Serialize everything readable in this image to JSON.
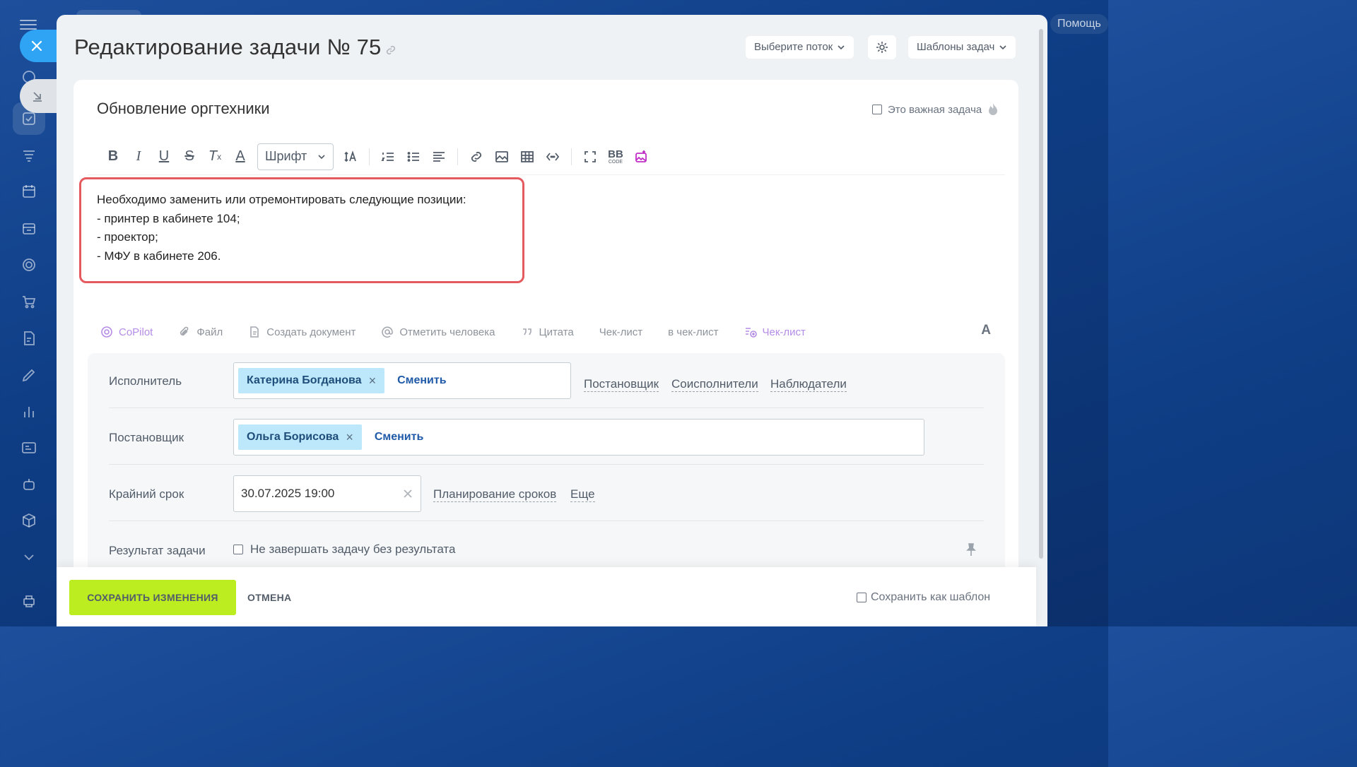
{
  "header": {
    "title": "Редактирование задачи № 75",
    "flow_select": "Выберите поток",
    "templates_select": "Шаблоны задач",
    "help": "Помощь"
  },
  "task": {
    "name": "Обновление оргтехники",
    "important_label": "Это важная задача",
    "description_lines": [
      "Необходимо заменить или отремонтировать следующие позиции:",
      "- принтер в кабинете 104;",
      "- проектор;",
      "- МФУ в кабинете 206."
    ]
  },
  "editor": {
    "font_select": "Шрифт",
    "toolbar_icons": [
      "bold-icon",
      "italic-icon",
      "underline-icon",
      "strikethrough-icon",
      "clear-format-icon",
      "text-color-icon",
      "font-size-icon",
      "ordered-list-icon",
      "bullet-list-icon",
      "align-icon",
      "link-icon",
      "image-icon",
      "table-icon",
      "code-icon",
      "fullscreen-icon",
      "bbcode-icon",
      "ai-image-icon"
    ],
    "bbcode_label": "BB",
    "bbcode_sub": "CODE"
  },
  "actions": {
    "copilot": "CoPilot",
    "file": "Файл",
    "create_document": "Создать документ",
    "mention": "Отметить человека",
    "quote": "Цитата",
    "checklist": "Чек-лист",
    "to_checklist": "в чек-лист",
    "checklist_add": "Чек-лист",
    "font_toggle": "A"
  },
  "fields": {
    "assignee": {
      "label": "Исполнитель",
      "person": "Катерина Богданова",
      "change": "Сменить",
      "links": [
        "Постановщик",
        "Соисполнители",
        "Наблюдатели"
      ]
    },
    "creator": {
      "label": "Постановщик",
      "person": "Ольга Борисова",
      "change": "Сменить"
    },
    "deadline": {
      "label": "Крайний срок",
      "value": "30.07.2025 19:00",
      "planning": "Планирование сроков",
      "more": "Еще"
    },
    "result": {
      "label": "Результат задачи",
      "checkbox_label": "Не завершать задачу без результата"
    }
  },
  "footer": {
    "save": "СОХРАНИТЬ ИЗМЕНЕНИЯ",
    "cancel": "ОТМЕНА",
    "save_template": "Сохранить как шаблон"
  },
  "colors": {
    "accent_save": "#bbed21",
    "highlight_border": "#e55a5f",
    "chip_bg": "#bde8fb",
    "close_button": "#2fa4f5"
  }
}
